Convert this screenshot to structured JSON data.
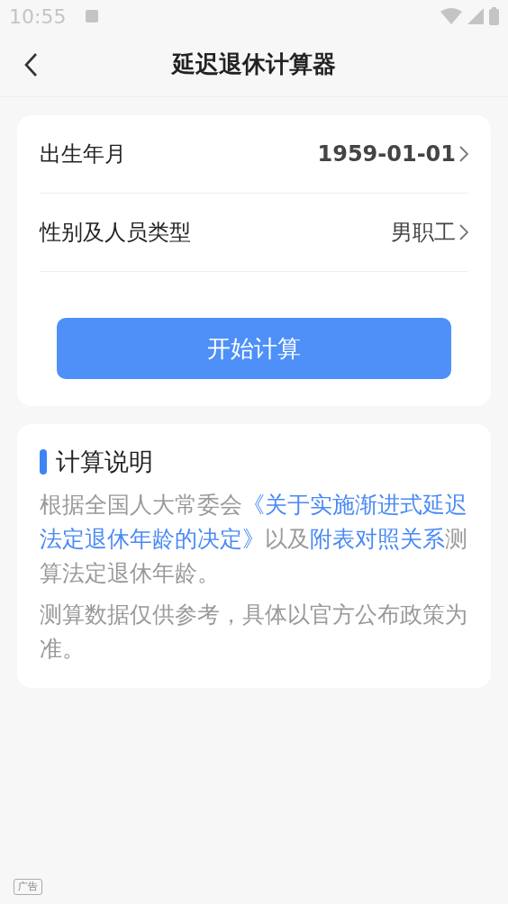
{
  "status_bar": {
    "time": "10:55"
  },
  "header": {
    "title": "延迟退休计算器"
  },
  "form": {
    "rows": [
      {
        "label": "出生年月",
        "value": "1959-01-01",
        "emphasis": true
      },
      {
        "label": "性别及人员类型",
        "value": "男职工",
        "emphasis": false
      }
    ],
    "button": "开始计算"
  },
  "info": {
    "title": "计算说明",
    "paragraphs": [
      [
        {
          "kind": "plain",
          "text": "根据全国人大常委会"
        },
        {
          "kind": "link",
          "text": "《关于实施渐进式延迟法定退休年龄的决定》"
        },
        {
          "kind": "plain",
          "text": "以及"
        },
        {
          "kind": "link",
          "text": "附表对照关系"
        },
        {
          "kind": "plain",
          "text": "测算法定退休年龄。"
        }
      ],
      [
        {
          "kind": "plain",
          "text": "测算数据仅供参考，具体以官方公布政策为准。"
        }
      ]
    ]
  },
  "ad_badge": "广告"
}
